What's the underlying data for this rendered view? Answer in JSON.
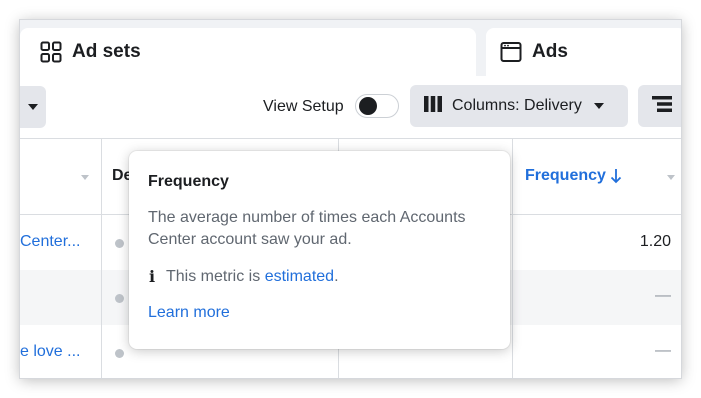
{
  "tabs": {
    "adsets_label": "Ad sets",
    "ads_label": "Ads"
  },
  "toolbar": {
    "view_setup_label": "View Setup",
    "view_setup_on": false,
    "columns_label": "Columns: Delivery"
  },
  "table": {
    "header_de": "De",
    "header_frequency": "Frequency",
    "rows": [
      {
        "name": "Center...",
        "frequency": "1.20"
      },
      {
        "name": "",
        "frequency": "—"
      },
      {
        "name": "e love ...",
        "frequency": "—"
      }
    ]
  },
  "tooltip": {
    "title": "Frequency",
    "description": "The average number of times each Accounts Center account saw your ad.",
    "note_prefix": "This metric is",
    "note_link": "estimated",
    "note_suffix": ".",
    "learn_more": "Learn more"
  },
  "colors": {
    "link_blue": "#216fdb",
    "button_gray": "#e4e6eb",
    "background": "#f0f2f5"
  },
  "icons": {
    "adsets": "grid-icon",
    "ads": "browser-window-icon",
    "columns": "columns-icon",
    "sort": "arrow-down-icon",
    "breakdown": "breakdown-icon",
    "info": "info-icon"
  }
}
